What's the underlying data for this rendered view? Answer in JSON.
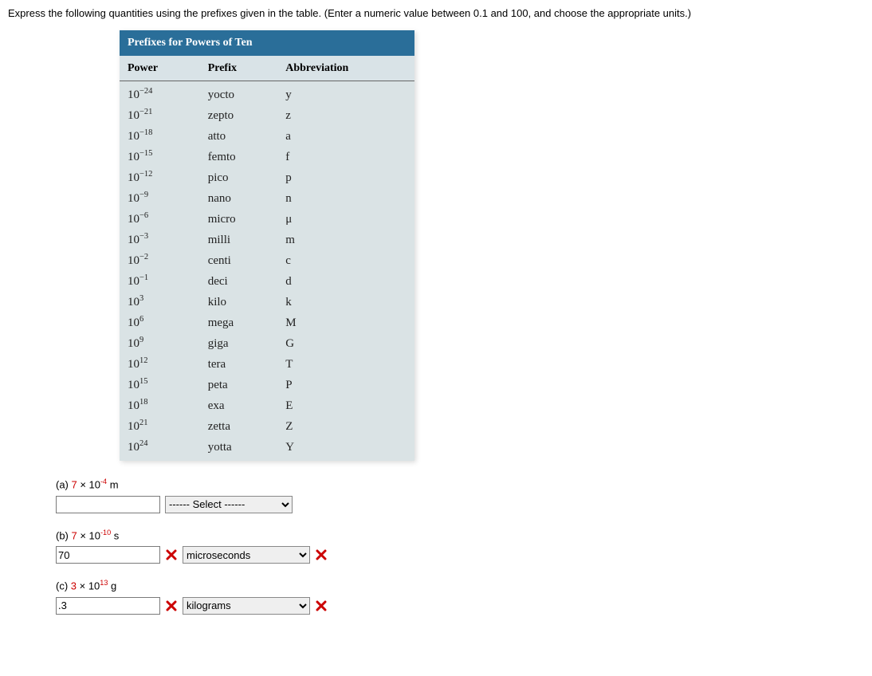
{
  "instruction": "Express the following quantities using the prefixes given in the table. (Enter a numeric value between 0.1 and 100, and choose the appropriate units.)",
  "table": {
    "title": "Prefixes for Powers of Ten",
    "headers": {
      "power": "Power",
      "prefix": "Prefix",
      "abbrev": "Abbreviation"
    },
    "rows": [
      {
        "power_base": "10",
        "power_exp": "−24",
        "prefix": "yocto",
        "abbrev": "y"
      },
      {
        "power_base": "10",
        "power_exp": "−21",
        "prefix": "zepto",
        "abbrev": "z"
      },
      {
        "power_base": "10",
        "power_exp": "−18",
        "prefix": "atto",
        "abbrev": "a"
      },
      {
        "power_base": "10",
        "power_exp": "−15",
        "prefix": "femto",
        "abbrev": "f"
      },
      {
        "power_base": "10",
        "power_exp": "−12",
        "prefix": "pico",
        "abbrev": "p"
      },
      {
        "power_base": "10",
        "power_exp": "−9",
        "prefix": "nano",
        "abbrev": "n"
      },
      {
        "power_base": "10",
        "power_exp": "−6",
        "prefix": "micro",
        "abbrev": "μ"
      },
      {
        "power_base": "10",
        "power_exp": "−3",
        "prefix": "milli",
        "abbrev": "m"
      },
      {
        "power_base": "10",
        "power_exp": "−2",
        "prefix": "centi",
        "abbrev": "c"
      },
      {
        "power_base": "10",
        "power_exp": "−1",
        "prefix": "deci",
        "abbrev": "d"
      },
      {
        "power_base": "10",
        "power_exp": "3",
        "prefix": "kilo",
        "abbrev": "k"
      },
      {
        "power_base": "10",
        "power_exp": "6",
        "prefix": "mega",
        "abbrev": "M"
      },
      {
        "power_base": "10",
        "power_exp": "9",
        "prefix": "giga",
        "abbrev": "G"
      },
      {
        "power_base": "10",
        "power_exp": "12",
        "prefix": "tera",
        "abbrev": "T"
      },
      {
        "power_base": "10",
        "power_exp": "15",
        "prefix": "peta",
        "abbrev": "P"
      },
      {
        "power_base": "10",
        "power_exp": "18",
        "prefix": "exa",
        "abbrev": "E"
      },
      {
        "power_base": "10",
        "power_exp": "21",
        "prefix": "zetta",
        "abbrev": "Z"
      },
      {
        "power_base": "10",
        "power_exp": "24",
        "prefix": "yotta",
        "abbrev": "Y"
      }
    ]
  },
  "questions": {
    "a": {
      "label_prefix": "(a) ",
      "coef": "7",
      "times": " × 10",
      "exp": "-4",
      "unit": " m",
      "value": "",
      "select": "------ Select ------",
      "wrong_value": false,
      "wrong_select": false
    },
    "b": {
      "label_prefix": "(b) ",
      "coef": "7",
      "times": " × 10",
      "exp": "-10",
      "unit": " s",
      "value": "70",
      "select": "microseconds",
      "wrong_value": true,
      "wrong_select": true
    },
    "c": {
      "label_prefix": "(c) ",
      "coef": "3",
      "times": " × 10",
      "exp": "13",
      "unit": " g",
      "value": ".3",
      "select": "kilograms",
      "wrong_value": true,
      "wrong_select": true
    }
  }
}
